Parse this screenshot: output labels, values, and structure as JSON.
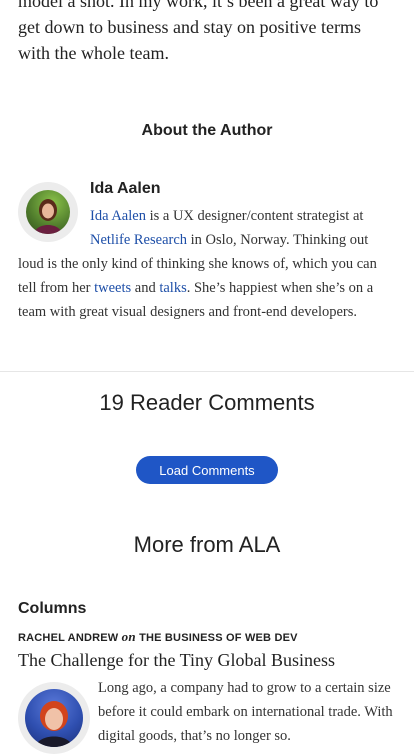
{
  "intro": {
    "text": "model a shot. In my work, it’s been a great way to get down to business and stay on positive terms with the whole team."
  },
  "about": {
    "title": "About the Author",
    "author_name": "Ida Aalen",
    "bio": {
      "name_link": "Ida Aalen",
      "text1": " is a UX designer/content strategist at ",
      "company_link": "Netlife Research",
      "text2": " in Oslo, Norway. Thinking out loud is the only kind of thinking she knows of, which you can tell from her ",
      "tweets_link": "tweets",
      "text3": " and ",
      "talks_link": "talks",
      "text4": ". She’s happiest when she’s on a team with great visual designers and front-end developers."
    }
  },
  "comments": {
    "count_label": "19 Reader Comments",
    "load_button": "Load Comments"
  },
  "more": {
    "title": "More from ALA",
    "section_label": "Columns",
    "byline_author": "Rachel Andrew",
    "byline_on": "on",
    "byline_column": "The Business of Web Dev",
    "article_title": "The Challenge for the Tiny Global Business",
    "excerpt": "Long ago, a company had to grow to a certain size before it could embark on international trade. With digital goods, that’s no longer so."
  },
  "colors": {
    "link": "#1e4fa8",
    "button": "#1f56c6"
  }
}
